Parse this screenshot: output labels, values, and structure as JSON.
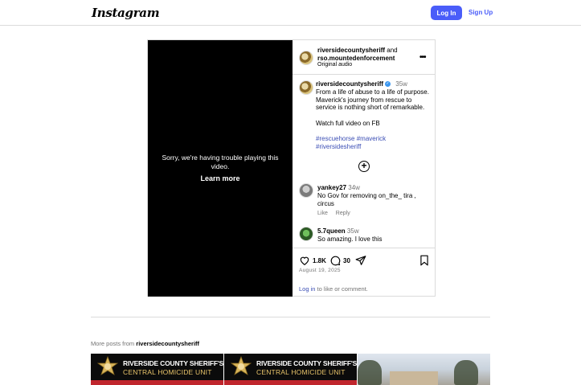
{
  "header": {
    "logo": "Instagram",
    "login_label": "Log In",
    "signup_label": "Sign Up"
  },
  "video": {
    "error_message": "Sorry, we're having trouble playing this video.",
    "learn_more": "Learn more"
  },
  "post_header": {
    "author": "riversidecountysheriff",
    "and_text": "and",
    "collaborator": "rso.mountedenforcement",
    "audio": "Original audio"
  },
  "caption": {
    "username": "riversidecountysheriff",
    "verified_mark": "✓",
    "time": "35w",
    "text": "From a life of abuse to a life of purpose. Maverick's journey from rescue to service is nothing short of remarkable.",
    "cta": "Watch full video on FB",
    "hashtags": [
      "#rescuehorse",
      "#maverick",
      "#riversidesheriff"
    ]
  },
  "comments": [
    {
      "username": "yankey27",
      "time": "34w",
      "text": "No Gov for removing on_the_ tira , circus",
      "like_label": "Like",
      "reply_label": "Reply"
    },
    {
      "username": "5.7queen",
      "time": "35w",
      "text": "So amazing. I love this"
    }
  ],
  "actions": {
    "likes": "1.8K",
    "comments": "30",
    "date": "August 19, 2025",
    "login_link": "Log in",
    "login_suffix": "to like or comment."
  },
  "more_posts": {
    "prefix": "More posts from",
    "username": "riversidecountysheriff",
    "thumbnails": [
      {
        "line1": "RIVERSIDE COUNTY SHERIFF'S OFFICE",
        "line2": "CENTRAL HOMICIDE UNIT"
      },
      {
        "line1": "RIVERSIDE COUNTY SHERIFF'S OFFICE",
        "line2": "CENTRAL HOMICIDE UNIT"
      }
    ]
  },
  "colors": {
    "brand_blue": "#4a5df9",
    "link_blue": "#3c4fb5",
    "verified_blue": "#3b97f0",
    "thumbnail_red": "#c0262d"
  }
}
